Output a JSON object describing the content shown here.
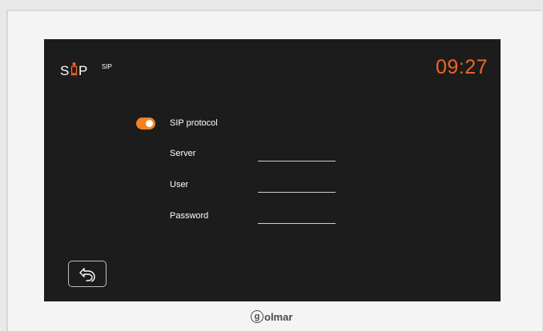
{
  "header": {
    "logo_text": "S P",
    "title": "SIP",
    "clock": "09:27"
  },
  "settings": {
    "sip_protocol": {
      "label": "SIP protocol",
      "enabled": true
    },
    "server": {
      "label": "Server",
      "value": ""
    },
    "user": {
      "label": "User",
      "value": ""
    },
    "password": {
      "label": "Password",
      "value": ""
    }
  },
  "footer": {
    "back_icon": "back-arrow-icon"
  },
  "brand": {
    "initial": "g",
    "rest": "olmar"
  },
  "colors": {
    "accent": "#f26522",
    "toggle": "#f58220",
    "screen_bg": "#1c1c1c"
  }
}
